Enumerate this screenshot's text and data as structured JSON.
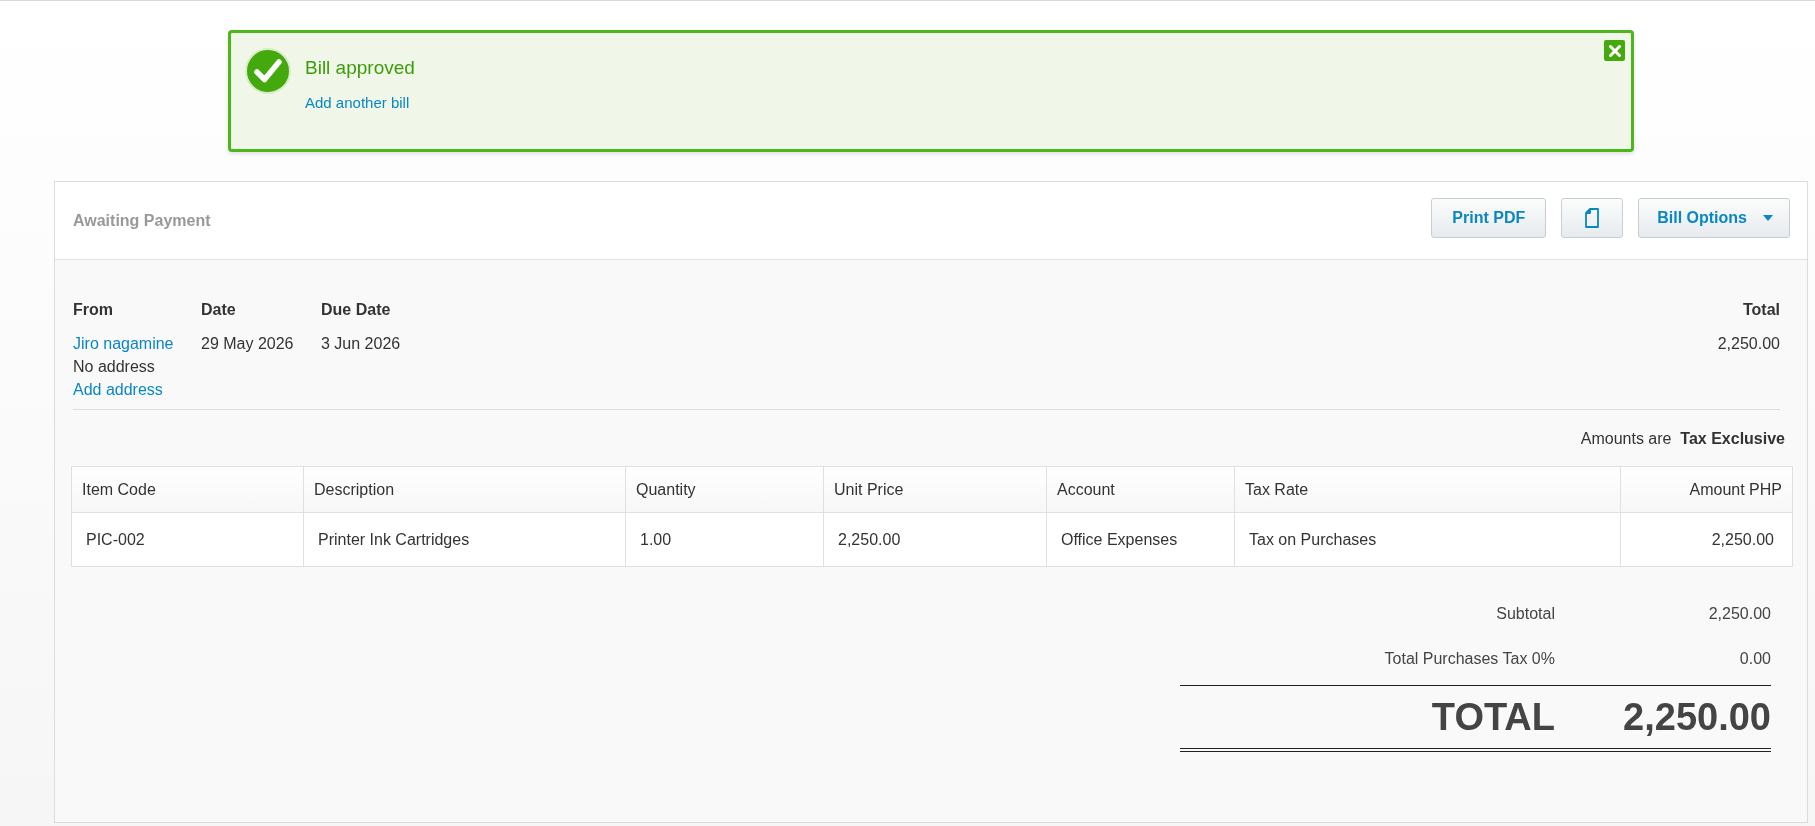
{
  "notification": {
    "title": "Bill approved",
    "link": "Add another bill"
  },
  "bill": {
    "status": "Awaiting Payment",
    "buttons": [
      {
        "kind": "text",
        "label": "Print PDF"
      },
      {
        "kind": "icon"
      },
      {
        "kind": "dropdown",
        "label": "Bill Options"
      }
    ]
  },
  "details": {
    "fields": [
      {
        "heading": "From",
        "lines": [
          {
            "kind": "link",
            "text": "Jiro nagamine"
          },
          {
            "kind": "text",
            "text": "No address"
          },
          {
            "kind": "link",
            "text": "Add address"
          }
        ]
      },
      {
        "heading": "Date",
        "lines": [
          {
            "kind": "text",
            "text": "29 May 2026"
          }
        ]
      },
      {
        "heading": "Due Date",
        "lines": [
          {
            "kind": "text",
            "text": "3 Jun 2026"
          }
        ]
      }
    ],
    "total": {
      "heading": "Total",
      "value": "2,250.00"
    }
  },
  "amounts_note": "Amounts are  **Tax Exclusive**",
  "table": {
    "columns": [
      "Item Code",
      "Description",
      "Quantity",
      "Unit Price",
      "Account",
      "Tax Rate",
      "Amount PHP"
    ],
    "rows": [
      [
        "PIC-002",
        "Printer Ink Cartridges",
        "1.00",
        "2,250.00",
        "Office Expenses",
        "Tax on Purchases",
        "2,250.00"
      ]
    ]
  },
  "totals": [
    {
      "kind": "line",
      "label": "Subtotal",
      "value": "2,250.00"
    },
    {
      "kind": "line",
      "label": "Total Purchases Tax 0%",
      "value": "0.00"
    },
    {
      "kind": "grand",
      "label": "TOTAL",
      "value": "2,250.00"
    }
  ]
}
